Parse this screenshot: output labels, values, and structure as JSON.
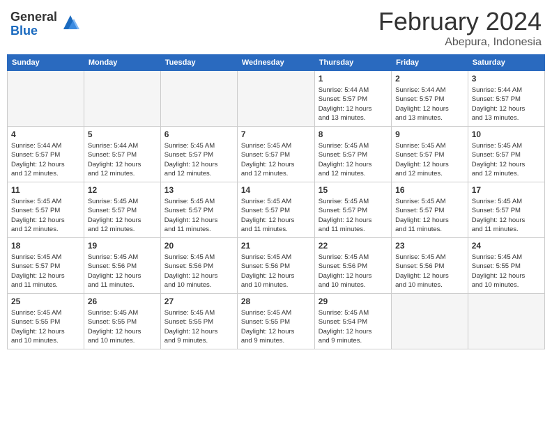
{
  "logo": {
    "general": "General",
    "blue": "Blue"
  },
  "title": "February 2024",
  "subtitle": "Abepura, Indonesia",
  "days_of_week": [
    "Sunday",
    "Monday",
    "Tuesday",
    "Wednesday",
    "Thursday",
    "Friday",
    "Saturday"
  ],
  "weeks": [
    [
      {
        "day": "",
        "info": ""
      },
      {
        "day": "",
        "info": ""
      },
      {
        "day": "",
        "info": ""
      },
      {
        "day": "",
        "info": ""
      },
      {
        "day": "1",
        "info": "Sunrise: 5:44 AM\nSunset: 5:57 PM\nDaylight: 12 hours\nand 13 minutes."
      },
      {
        "day": "2",
        "info": "Sunrise: 5:44 AM\nSunset: 5:57 PM\nDaylight: 12 hours\nand 13 minutes."
      },
      {
        "day": "3",
        "info": "Sunrise: 5:44 AM\nSunset: 5:57 PM\nDaylight: 12 hours\nand 13 minutes."
      }
    ],
    [
      {
        "day": "4",
        "info": "Sunrise: 5:44 AM\nSunset: 5:57 PM\nDaylight: 12 hours\nand 12 minutes."
      },
      {
        "day": "5",
        "info": "Sunrise: 5:44 AM\nSunset: 5:57 PM\nDaylight: 12 hours\nand 12 minutes."
      },
      {
        "day": "6",
        "info": "Sunrise: 5:45 AM\nSunset: 5:57 PM\nDaylight: 12 hours\nand 12 minutes."
      },
      {
        "day": "7",
        "info": "Sunrise: 5:45 AM\nSunset: 5:57 PM\nDaylight: 12 hours\nand 12 minutes."
      },
      {
        "day": "8",
        "info": "Sunrise: 5:45 AM\nSunset: 5:57 PM\nDaylight: 12 hours\nand 12 minutes."
      },
      {
        "day": "9",
        "info": "Sunrise: 5:45 AM\nSunset: 5:57 PM\nDaylight: 12 hours\nand 12 minutes."
      },
      {
        "day": "10",
        "info": "Sunrise: 5:45 AM\nSunset: 5:57 PM\nDaylight: 12 hours\nand 12 minutes."
      }
    ],
    [
      {
        "day": "11",
        "info": "Sunrise: 5:45 AM\nSunset: 5:57 PM\nDaylight: 12 hours\nand 12 minutes."
      },
      {
        "day": "12",
        "info": "Sunrise: 5:45 AM\nSunset: 5:57 PM\nDaylight: 12 hours\nand 12 minutes."
      },
      {
        "day": "13",
        "info": "Sunrise: 5:45 AM\nSunset: 5:57 PM\nDaylight: 12 hours\nand 11 minutes."
      },
      {
        "day": "14",
        "info": "Sunrise: 5:45 AM\nSunset: 5:57 PM\nDaylight: 12 hours\nand 11 minutes."
      },
      {
        "day": "15",
        "info": "Sunrise: 5:45 AM\nSunset: 5:57 PM\nDaylight: 12 hours\nand 11 minutes."
      },
      {
        "day": "16",
        "info": "Sunrise: 5:45 AM\nSunset: 5:57 PM\nDaylight: 12 hours\nand 11 minutes."
      },
      {
        "day": "17",
        "info": "Sunrise: 5:45 AM\nSunset: 5:57 PM\nDaylight: 12 hours\nand 11 minutes."
      }
    ],
    [
      {
        "day": "18",
        "info": "Sunrise: 5:45 AM\nSunset: 5:57 PM\nDaylight: 12 hours\nand 11 minutes."
      },
      {
        "day": "19",
        "info": "Sunrise: 5:45 AM\nSunset: 5:56 PM\nDaylight: 12 hours\nand 11 minutes."
      },
      {
        "day": "20",
        "info": "Sunrise: 5:45 AM\nSunset: 5:56 PM\nDaylight: 12 hours\nand 10 minutes."
      },
      {
        "day": "21",
        "info": "Sunrise: 5:45 AM\nSunset: 5:56 PM\nDaylight: 12 hours\nand 10 minutes."
      },
      {
        "day": "22",
        "info": "Sunrise: 5:45 AM\nSunset: 5:56 PM\nDaylight: 12 hours\nand 10 minutes."
      },
      {
        "day": "23",
        "info": "Sunrise: 5:45 AM\nSunset: 5:56 PM\nDaylight: 12 hours\nand 10 minutes."
      },
      {
        "day": "24",
        "info": "Sunrise: 5:45 AM\nSunset: 5:55 PM\nDaylight: 12 hours\nand 10 minutes."
      }
    ],
    [
      {
        "day": "25",
        "info": "Sunrise: 5:45 AM\nSunset: 5:55 PM\nDaylight: 12 hours\nand 10 minutes."
      },
      {
        "day": "26",
        "info": "Sunrise: 5:45 AM\nSunset: 5:55 PM\nDaylight: 12 hours\nand 10 minutes."
      },
      {
        "day": "27",
        "info": "Sunrise: 5:45 AM\nSunset: 5:55 PM\nDaylight: 12 hours\nand 9 minutes."
      },
      {
        "day": "28",
        "info": "Sunrise: 5:45 AM\nSunset: 5:55 PM\nDaylight: 12 hours\nand 9 minutes."
      },
      {
        "day": "29",
        "info": "Sunrise: 5:45 AM\nSunset: 5:54 PM\nDaylight: 12 hours\nand 9 minutes."
      },
      {
        "day": "",
        "info": ""
      },
      {
        "day": "",
        "info": ""
      }
    ]
  ]
}
